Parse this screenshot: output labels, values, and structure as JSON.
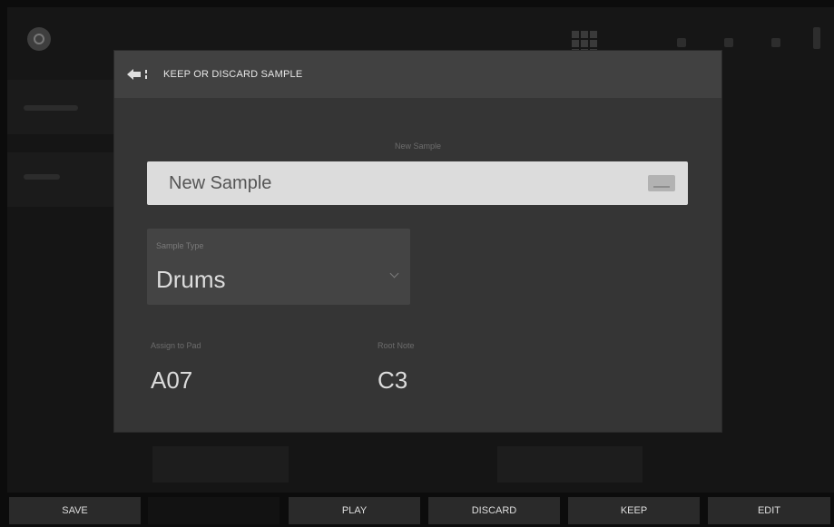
{
  "dialog": {
    "title": "KEEP OR DISCARD SAMPLE",
    "caption": "New Sample",
    "name_value": "New Sample",
    "type_label": "Sample Type",
    "type_value": "Drums",
    "assign_label": "Assign to Pad",
    "assign_value": "A07",
    "root_label": "Root Note",
    "root_value": "C3"
  },
  "footer": {
    "save": "SAVE",
    "play": "PLAY",
    "discard": "DISCARD",
    "keep": "KEEP",
    "edit": "EDIT"
  },
  "icons": [
    "logo-icon",
    "pad-grid-icon",
    "back-icon",
    "keyboard-icon",
    "chevron-down-icon"
  ],
  "colors": {
    "background": "#151515",
    "dialog": "#353535",
    "dialog_header": "#414141",
    "field": "#dcdcdc",
    "soft_key": "#2a2a2a"
  }
}
